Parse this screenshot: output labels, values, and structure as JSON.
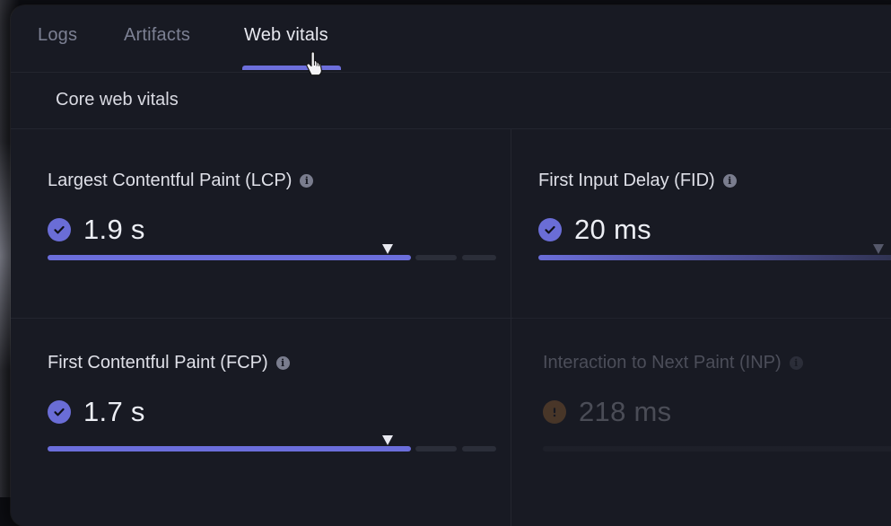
{
  "tabs": [
    {
      "label": "Logs",
      "active": false
    },
    {
      "label": "Artifacts",
      "active": false
    },
    {
      "label": "Web vitals",
      "active": true
    }
  ],
  "section": {
    "title": "Core web vitals"
  },
  "metrics": [
    {
      "label": "Largest Contentful Paint (LCP)",
      "value": "1.9 s",
      "status": "good",
      "progress": 0.76
    },
    {
      "label": "First Input Delay (FID)",
      "value": "20 ms",
      "status": "good",
      "progress": 0.95
    },
    {
      "label": "First Contentful Paint (FCP)",
      "value": "1.7 s",
      "status": "good",
      "progress": 0.76
    },
    {
      "label": "Interaction to Next Paint (INP)",
      "value": "218 ms",
      "status": "needs-improvement",
      "progress": 0.0
    }
  ],
  "icons": {
    "info": "info-icon",
    "good": "check-circle-icon",
    "warn": "exclamation-circle-icon",
    "cursor": "hand-pointer-icon"
  },
  "colors": {
    "accent": "#6b6edb",
    "warning": "#b07335",
    "panel": "#181a23"
  }
}
